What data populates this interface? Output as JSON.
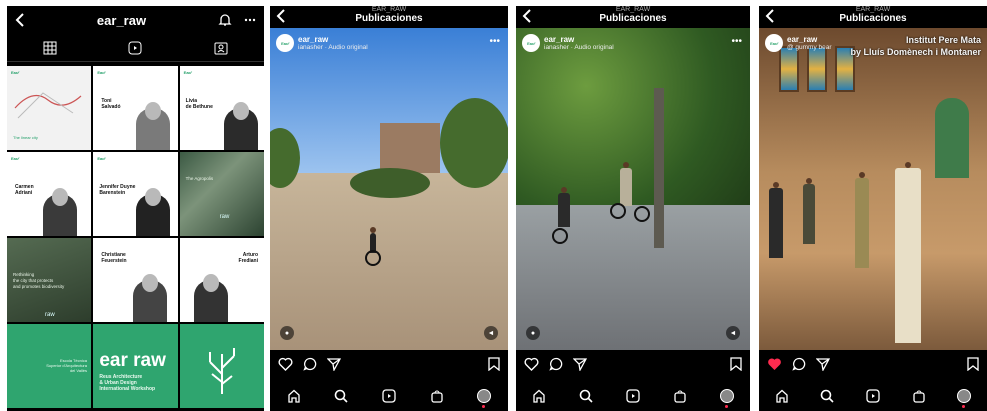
{
  "profile": {
    "username": "ear_raw",
    "grid": {
      "tag": "Ear⁄⁄",
      "cells": [
        {
          "type": "map",
          "caption": "The linear city"
        },
        {
          "type": "person",
          "name": "Toni\nSalvadó"
        },
        {
          "type": "person",
          "name": "Livia\nde Bethune"
        },
        {
          "type": "person",
          "name": "Carmen\nAdriani"
        },
        {
          "type": "person",
          "name": "Jennifer Duyne\nBarenstein"
        },
        {
          "type": "sat",
          "caption": "The Agropolis"
        },
        {
          "type": "dark",
          "caption": "Rethinking\nthe city that protects\nand promotes biodiversity"
        },
        {
          "type": "person",
          "name": "Christiane\nFeuerstein"
        },
        {
          "type": "person",
          "name": "Arturo\nFrediani"
        },
        {
          "type": "green-school",
          "caption": "Escola Tècnica\nSuperior d'Arquitectura\ndel Vallès"
        },
        {
          "type": "green-logo",
          "title": "ear raw",
          "caption": "Reus Architecture\n& Urban Design\nInternational Workshop"
        },
        {
          "type": "green-tree",
          "caption": ""
        }
      ],
      "small_raw": "raw"
    }
  },
  "reels": [
    {
      "top_title": "EAR_RAW",
      "header": "Publicaciones",
      "user": "ear_raw",
      "audio": "ianasher · Audio original",
      "overlay": "",
      "liked": false
    },
    {
      "top_title": "EAR_RAW",
      "header": "Publicaciones",
      "user": "ear_raw",
      "audio": "ianasher · Audio original",
      "overlay": "",
      "liked": false
    },
    {
      "top_title": "EAR_RAW",
      "header": "Publicaciones",
      "user": "ear_raw",
      "audio": "@ gummy bear",
      "overlay": "Institut Pere Mata\nby Lluís Domènech i Montaner",
      "liked": true
    }
  ],
  "avatar_text": "Ear⁄⁄",
  "colors": {
    "brand_green": "#2fa56f",
    "like_red": "#ff2b4f"
  }
}
